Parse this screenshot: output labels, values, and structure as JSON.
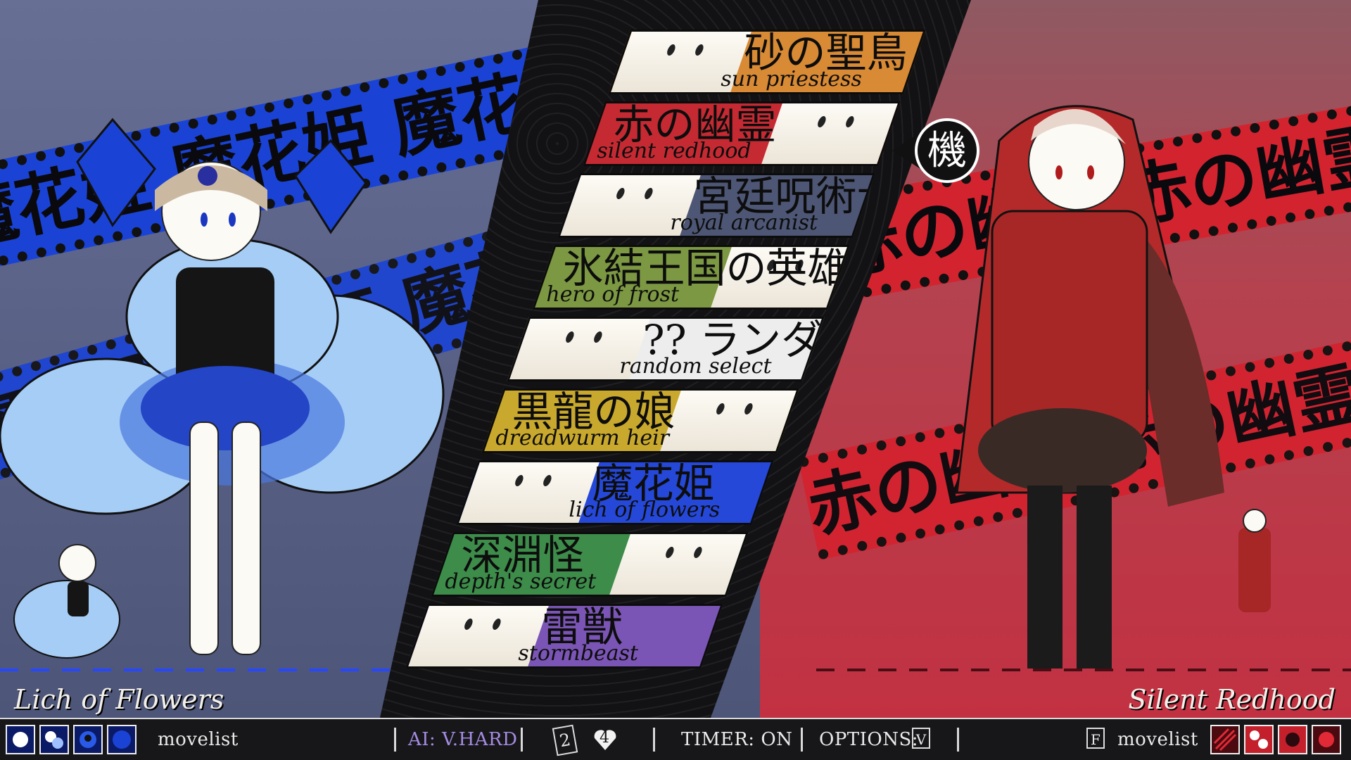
{
  "p1": {
    "name": "Lich of Flowers",
    "banner_text": "魔花姫 魔花姫 魔花姫",
    "movelist_label": "movelist"
  },
  "p2": {
    "name": "Silent Redhood",
    "banner_text": "赤の幽霊 赤の幽霊 赤の幽霊",
    "movelist_label": "movelist",
    "movelist_key": "F"
  },
  "cursor": {
    "glyph": "機"
  },
  "roster": [
    {
      "jp": "砂の聖鳥",
      "en": "sun priestess",
      "color": "#d88a34"
    },
    {
      "jp": "赤の幽霊",
      "en": "silent redhood",
      "color": "#c52a33"
    },
    {
      "jp": "宮廷呪術士",
      "en": "royal arcanist",
      "color": "#4d5674"
    },
    {
      "jp": "氷結王国の英雄",
      "en": "hero of frost",
      "color": "#7c9842"
    },
    {
      "jp": "??  ランダムセレクト",
      "en": "random select",
      "color": "#ededed"
    },
    {
      "jp": "黒龍の娘",
      "en": "dreadwurm heir",
      "color": "#c9a92d"
    },
    {
      "jp": "魔花姫",
      "en": "lich of flowers",
      "color": "#2548d8"
    },
    {
      "jp": "深淵怪",
      "en": "depth's secret",
      "color": "#3d8c4a"
    },
    {
      "jp": "雷獣",
      "en": "stormbeast",
      "color": "#7a55b5"
    }
  ],
  "hud": {
    "ai_label": "AI: V.HARD",
    "wins_left": "2",
    "wins_right": "4",
    "timer_label": "TIMER: ON",
    "options_label": "OPTIONS:",
    "options_key": "V"
  },
  "colors": {
    "p1_accent": "#1a43d6",
    "p2_accent": "#d3232f",
    "hud_bg": "#17171a"
  }
}
